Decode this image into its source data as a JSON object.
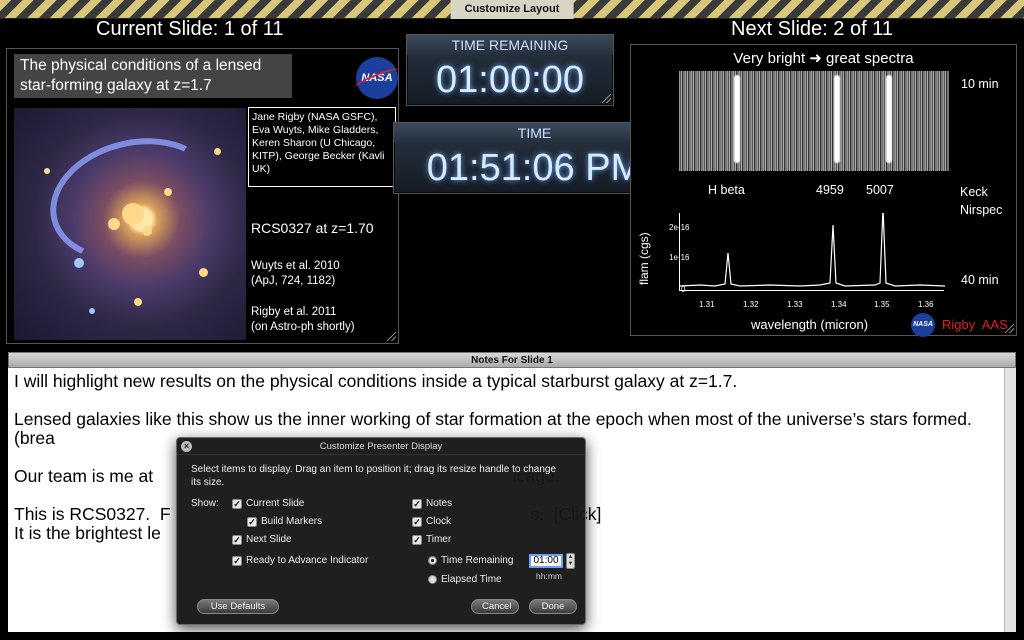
{
  "window": {
    "title": "Customize Layout"
  },
  "current": {
    "header": "Current Slide: 1 of 11",
    "title": "The physical conditions of a lensed star-forming galaxy at z=1.7",
    "logo": "NASA",
    "authors": "Jane Rigby (NASA GSFC), Eva Wuyts, Mike Gladders, Keren Sharon (U Chicago, KITP), George Becker (Kavli UK)",
    "target": "RCS0327 at z=1.70",
    "ref1": "Wuyts et al. 2010\n(ApJ, 724, 1182)",
    "ref2": "Rigby et al. 2011\n(on Astro-ph shortly)"
  },
  "timers": {
    "remaining_label": "TIME REMAINING",
    "remaining_value": "01:00:00",
    "time_label": "TIME",
    "time_value": "01:51:06 PM"
  },
  "next": {
    "header": "Next Slide: 2 of 11",
    "title": "Very bright ➜ great spectra",
    "t10": "10 min",
    "hbeta": "H beta",
    "l4959": "4959",
    "l5007": "5007",
    "inst": "Keck\nNirspec",
    "t40": "40 min",
    "ylabel": "flam (cgs)",
    "xlabel": "wavelength (micron)",
    "xticks": [
      "1.31",
      "1.32",
      "1.33",
      "1.34",
      "1.35",
      "1.36"
    ],
    "yticks": [
      "2e-16",
      "1e-16",
      "0"
    ],
    "footer_logo": "NASA",
    "footer": "Rigby  AAS"
  },
  "notes": {
    "title": "Notes For Slide 1",
    "text": "I will highlight new results on the physical conditions inside a typical starburst galaxy at z=1.7.\n\nLensed galaxies like this show us the inner working of star formation at the epoch when most of the universe’s stars formed.  (brea\n\nOur team is me at                                                                          icago.\n\nThis is RCS0327.  F                                                                          s.  [Click]\nIt is the brightest le"
  },
  "dialog": {
    "title": "Customize Presenter Display",
    "instructions": "Select items to display. Drag an item to position it; drag its resize handle to change its size.",
    "show_label": "Show:",
    "options": {
      "current_slide": "Current Slide",
      "build_markers": "Build Markers",
      "next_slide": "Next Slide",
      "ready": "Ready to Advance Indicator",
      "notes": "Notes",
      "clock": "Clock",
      "timer": "Timer",
      "time_remaining": "Time Remaining",
      "elapsed_time": "Elapsed Time"
    },
    "timer_value": "01:00",
    "timer_unit": "hh:mm",
    "use_defaults": "Use Defaults",
    "cancel": "Cancel",
    "done": "Done"
  }
}
